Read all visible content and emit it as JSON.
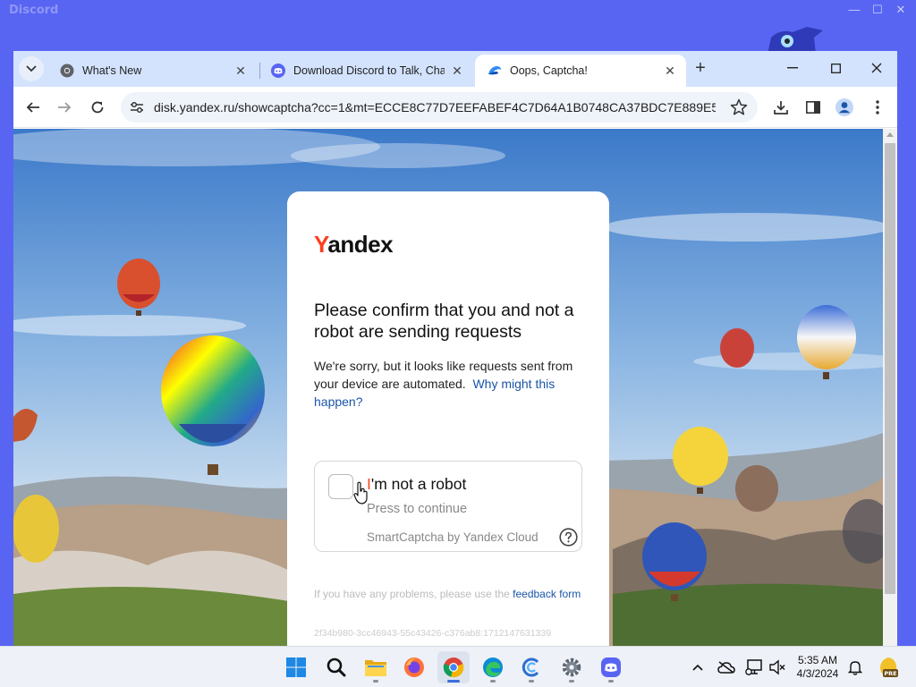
{
  "discord_window": {
    "title": "Discord"
  },
  "browser": {
    "tabs": [
      {
        "label": "What's New",
        "icon": "chrome-icon",
        "active": false
      },
      {
        "label": "Download Discord to Talk, Chat",
        "icon": "discord-icon",
        "active": false
      },
      {
        "label": "Oops, Captcha!",
        "icon": "yandex-disk-icon",
        "active": true
      }
    ],
    "address": "disk.yandex.ru/showcaptcha?cc=1&mt=ECCE8C77D7EEFABEF4C7D64A1B0748CA37BDC7E889E5AD5..."
  },
  "captcha": {
    "logo_initial": "Y",
    "logo_rest": "andex",
    "heading": "Please confirm that you and not a robot are sending requests",
    "description": "We're sorry, but it looks like requests sent from your device are automated.",
    "why_link": "Why might this happen?",
    "checkbox_initial": "I",
    "checkbox_rest": "'m not a robot",
    "checkbox_hint": "Press to continue",
    "provider": "SmartCaptcha by Yandex Cloud",
    "feedback_prefix": "If you have any problems, please use the",
    "feedback_link": "feedback form",
    "request_id": "2f34b980-3cc46943-55c43426-c376ab8:1712147631339"
  },
  "taskbar": {
    "apps": [
      "windows-start-icon",
      "search-icon",
      "file-explorer-icon",
      "firefox-icon",
      "chrome-icon",
      "edge-icon",
      "ccleaner-icon",
      "settings-icon",
      "discord-icon"
    ],
    "active_app": "chrome-icon",
    "time": "5:35 AM",
    "date": "4/3/2024",
    "badge": "PRE"
  },
  "colors": {
    "discord": "#5865f2",
    "tabstrip": "#d3e3fd",
    "yandex_red": "#fc3f1d",
    "link_blue": "#1a55a8"
  }
}
